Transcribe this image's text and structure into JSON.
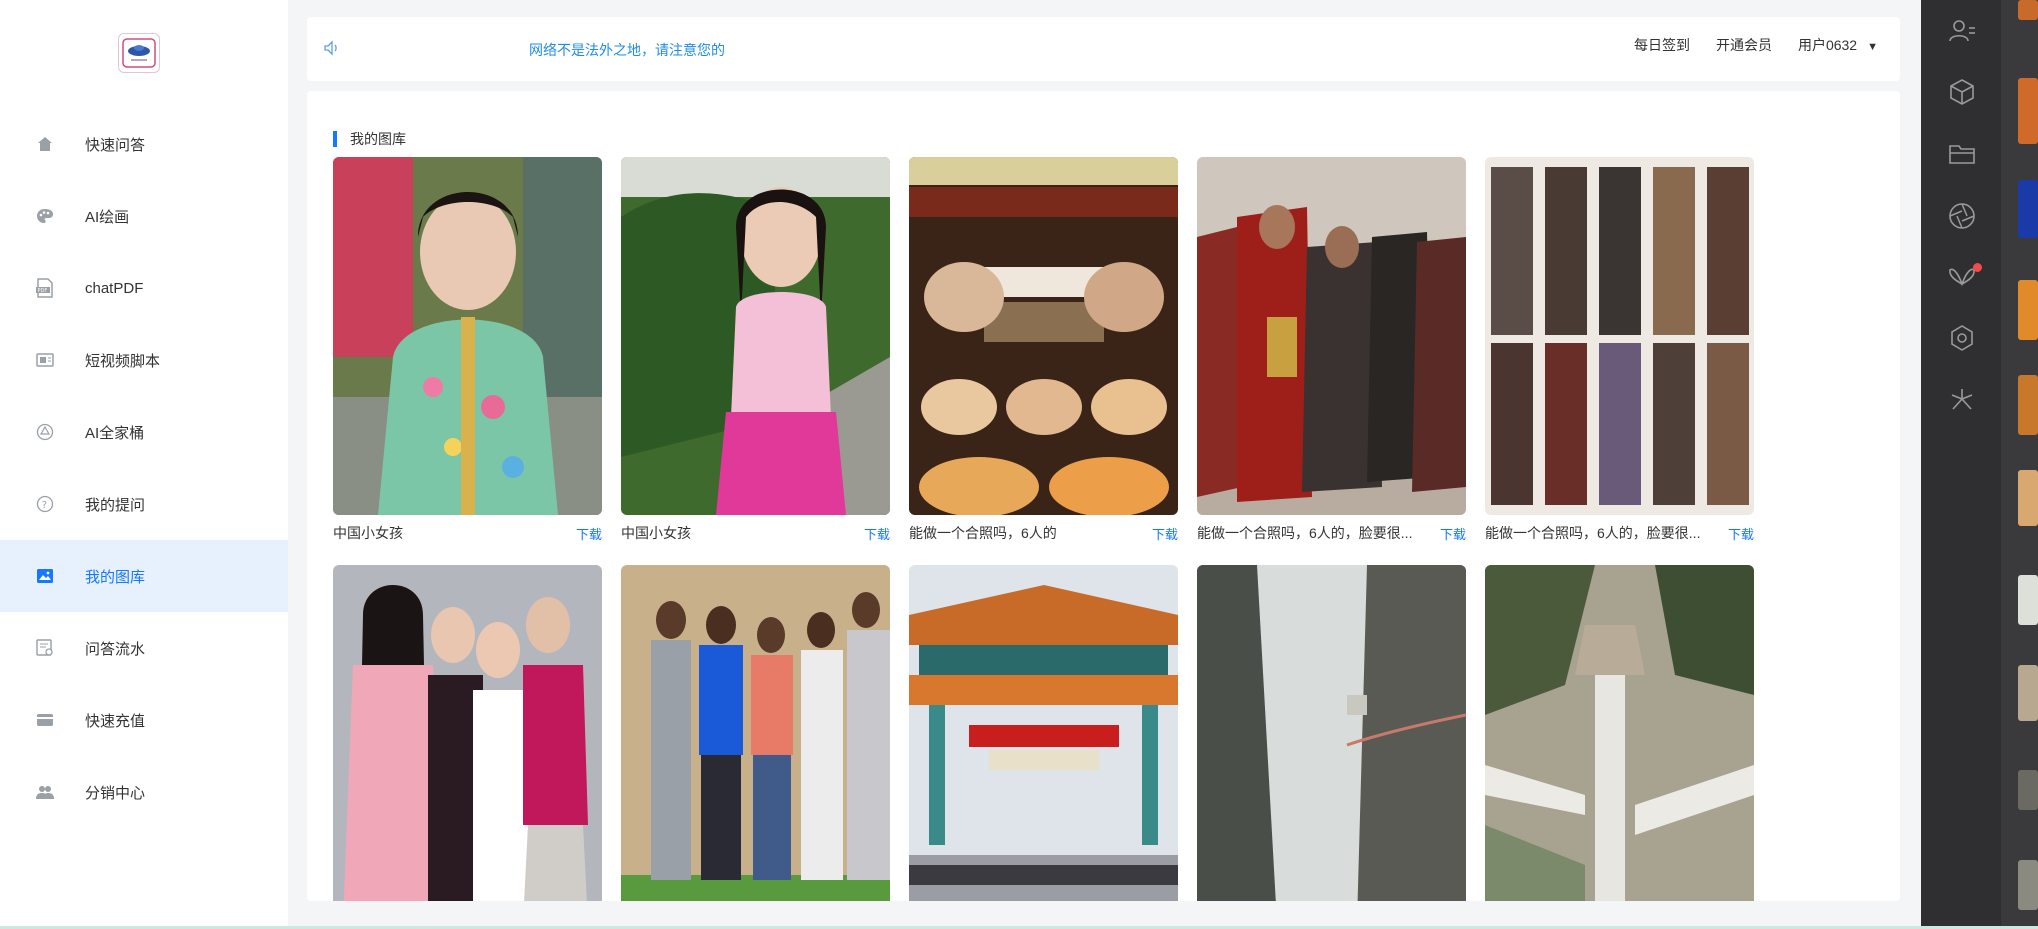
{
  "sidebar": {
    "items": [
      {
        "label": "快速问答",
        "icon": "home-icon"
      },
      {
        "label": "AI绘画",
        "icon": "palette-icon"
      },
      {
        "label": "chatPDF",
        "icon": "pdf-icon"
      },
      {
        "label": "短视频脚本",
        "icon": "video-icon"
      },
      {
        "label": "AI全家桶",
        "icon": "apps-icon"
      },
      {
        "label": "我的提问",
        "icon": "question-icon"
      },
      {
        "label": "我的图库",
        "icon": "image-icon",
        "active": true
      },
      {
        "label": "问答流水",
        "icon": "ledger-icon"
      },
      {
        "label": "快速充值",
        "icon": "card-icon"
      },
      {
        "label": "分销中心",
        "icon": "people-icon"
      }
    ]
  },
  "topbar": {
    "notice": "网络不是法外之地，请注意您的",
    "checkin": "每日签到",
    "vip": "开通会员",
    "user": "用户0632",
    "caret": "▼"
  },
  "gallery": {
    "title": "我的图库",
    "download_label": "下载",
    "items": [
      {
        "title": "中国小女孩",
        "image": "girl-floral-dress"
      },
      {
        "title": "中国小女孩",
        "image": "girl-pink-dress"
      },
      {
        "title": "能做一个合照吗，6人的",
        "image": "food-display"
      },
      {
        "title": "能做一个合照吗，6人的，脸要很...",
        "image": "warriors-group"
      },
      {
        "title": "能做一个合照吗，6人的，脸要很...",
        "image": "warriors-grid"
      },
      {
        "title": "",
        "image": "women-group"
      },
      {
        "title": "",
        "image": "people-group"
      },
      {
        "title": "",
        "image": "chinese-gate"
      },
      {
        "title": "",
        "image": "mountain-cliff"
      },
      {
        "title": "",
        "image": "mountain-path"
      }
    ]
  },
  "colors": {
    "accent": "#1677ff",
    "notice": "#1f8ceb",
    "rail": "#2f2f31",
    "active_bg": "#e6f1fd"
  },
  "rail": {
    "icons": [
      "user-list-icon",
      "cube-icon",
      "folder-icon",
      "aperture-icon",
      "butterfly-icon",
      "hexagon-gear-icon",
      "sparkle-icon"
    ]
  }
}
